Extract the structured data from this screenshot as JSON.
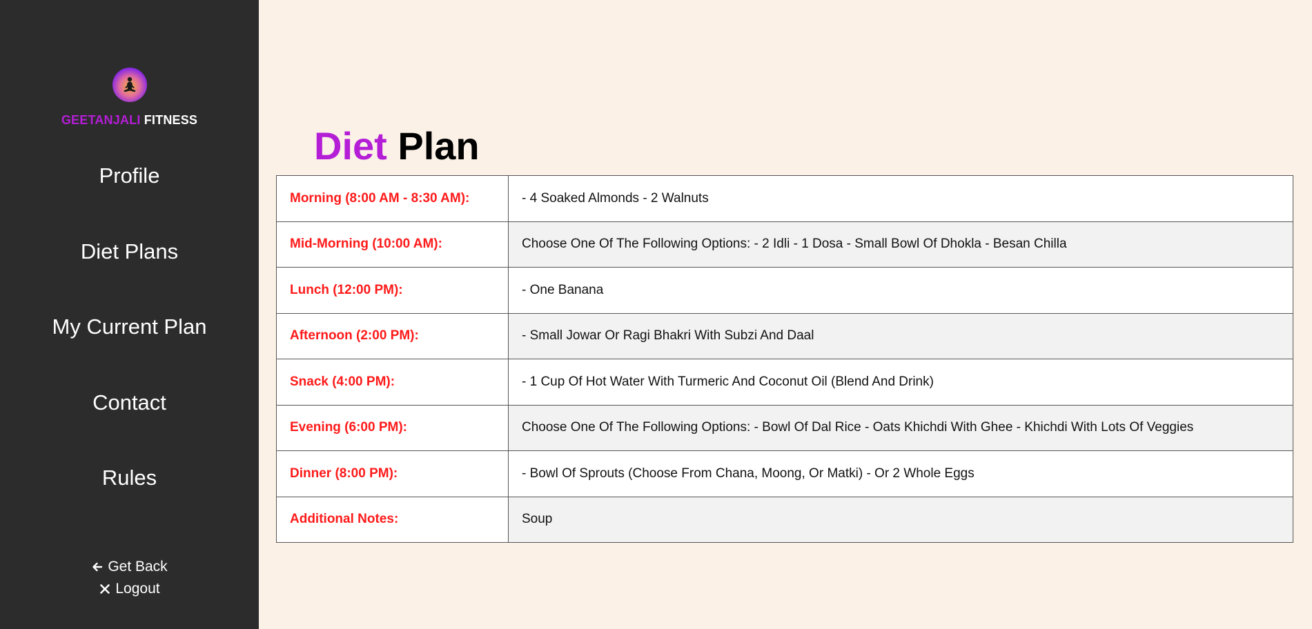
{
  "brand": {
    "logo_icon": "meditation-logo-icon",
    "name_part1": "GEETANJALI",
    "name_part2": "FITNESS"
  },
  "nav": {
    "items": [
      {
        "label": "Profile"
      },
      {
        "label": "Diet Plans"
      },
      {
        "label": "My Current Plan"
      },
      {
        "label": "Contact"
      },
      {
        "label": "Rules"
      }
    ],
    "get_back": {
      "icon": "arrow-left-icon",
      "label": "Get Back"
    },
    "logout": {
      "icon": "close-icon",
      "label": "Logout"
    }
  },
  "page": {
    "title_part1": "Diet",
    "title_part2": "Plan"
  },
  "plan": {
    "rows": [
      {
        "time": "Morning (8:00 AM - 8:30 AM):",
        "item": "- 4 Soaked Almonds - 2 Walnuts"
      },
      {
        "time": "Mid-Morning (10:00 AM):",
        "item": "Choose One Of The Following Options: - 2 Idli - 1 Dosa - Small Bowl Of Dhokla - Besan Chilla"
      },
      {
        "time": "Lunch (12:00 PM):",
        "item": "- One Banana"
      },
      {
        "time": "Afternoon (2:00 PM):",
        "item": "- Small Jowar Or Ragi Bhakri With Subzi And Daal"
      },
      {
        "time": "Snack (4:00 PM):",
        "item": "- 1 Cup Of Hot Water With Turmeric And Coconut Oil (Blend And Drink)"
      },
      {
        "time": "Evening (6:00 PM):",
        "item": "Choose One Of The Following Options: - Bowl Of Dal Rice - Oats Khichdi With Ghee - Khichdi With Lots Of Veggies"
      },
      {
        "time": "Dinner (8:00 PM):",
        "item": "- Bowl Of Sprouts (Choose From Chana, Moong, Or Matki) - Or 2 Whole Eggs"
      },
      {
        "time": "Additional Notes:",
        "item": "Soup"
      }
    ]
  },
  "colors": {
    "sidebar_bg": "#2c2c2c",
    "page_bg": "#fbf1e7",
    "accent_purple": "#b41ed6",
    "time_red": "#ff1a1a"
  }
}
